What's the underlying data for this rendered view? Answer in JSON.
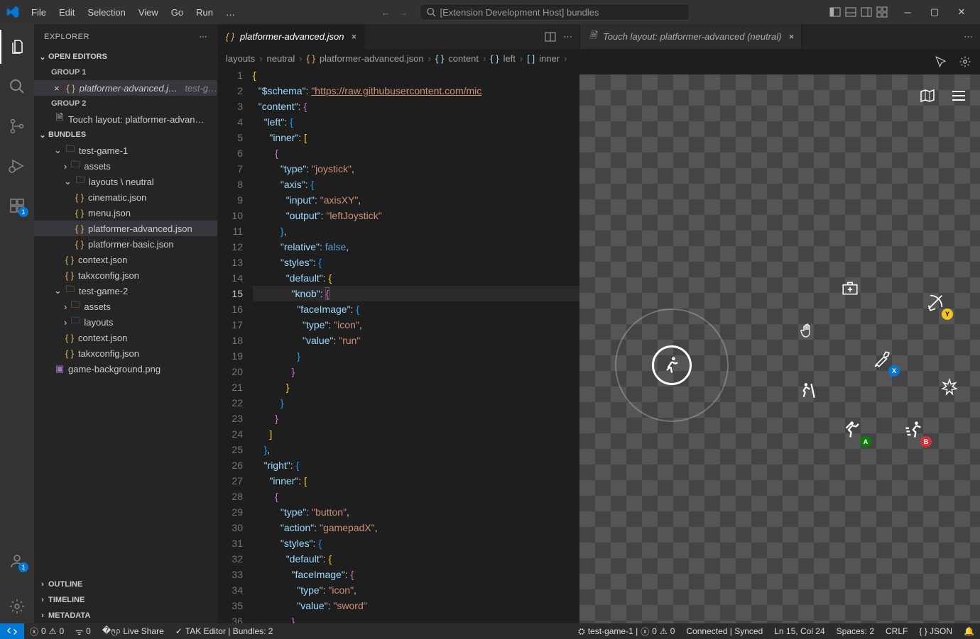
{
  "title": "[Extension Development Host] bundles",
  "menu": [
    "File",
    "Edit",
    "Selection",
    "View",
    "Go",
    "Run",
    "…"
  ],
  "explorer": {
    "title": "EXPLORER"
  },
  "sections": {
    "openEditors": "OPEN EDITORS",
    "group1": "GROUP 1",
    "group2": "GROUP 2",
    "bundles": "BUNDLES",
    "outline": "OUTLINE",
    "timeline": "TIMELINE",
    "metadata": "METADATA"
  },
  "openEditors": {
    "g1_file": "platformer-advanced.json",
    "g1_hint": "test-g…",
    "g2_file": "Touch layout: platformer-advan…"
  },
  "tree": {
    "game1": "test-game-1",
    "assets": "assets",
    "layouts": "layouts \\ neutral",
    "cinematic": "cinematic.json",
    "menu": "menu.json",
    "platAdv": "platformer-advanced.json",
    "platBasic": "platformer-basic.json",
    "context1": "context.json",
    "takx1": "takxconfig.json",
    "game2": "test-game-2",
    "assets2": "assets",
    "layouts2": "layouts",
    "context2": "context.json",
    "takx2": "takxconfig.json",
    "bg": "game-background.png"
  },
  "tabs": {
    "left": "platformer-advanced.json",
    "right": "Touch layout: platformer-advanced (neutral)"
  },
  "breadcrumb": [
    "layouts",
    "neutral",
    "platformer-advanced.json",
    "content",
    "left",
    "inner"
  ],
  "code": {
    "schemaKey": "\"$schema\"",
    "schemaVal": "\"https://raw.githubusercontent.com/mic",
    "contentKey": "\"content\"",
    "leftKey": "\"left\"",
    "innerKey": "\"inner\"",
    "typeKey": "\"type\"",
    "joyVal": "\"joystick\"",
    "axisKey": "\"axis\"",
    "inputKey": "\"input\"",
    "axisXY": "\"axisXY\"",
    "outputKey": "\"output\"",
    "leftJoy": "\"leftJoystick\"",
    "relKey": "\"relative\"",
    "falseVal": "false",
    "stylesKey": "\"styles\"",
    "defaultKey": "\"default\"",
    "knobKey": "\"knob\"",
    "faceKey": "\"faceImage\"",
    "iconVal": "\"icon\"",
    "valueKey": "\"value\"",
    "runVal": "\"run\"",
    "rightKey": "\"right\"",
    "buttonVal": "\"button\"",
    "actionKey": "\"action\"",
    "gamepadX": "\"gamepadX\"",
    "swordVal": "\"sword\""
  },
  "touchButtons": {
    "y_label": "Y",
    "x_label": "X",
    "a_label": "A",
    "b_label": "B"
  },
  "statusLeft": {
    "errors": "0",
    "warnings": "0",
    "ports": "0",
    "liveshare": "Live Share",
    "tak": "TAK Editor | Bundles: 2"
  },
  "statusRight": {
    "game": "test-game-1 |",
    "errors": "0",
    "warnings": "0",
    "connected": "Connected | Synced",
    "pos": "Ln 15, Col 24",
    "spaces": "Spaces: 2",
    "eol": "CRLF",
    "lang": "{ }  JSON"
  }
}
